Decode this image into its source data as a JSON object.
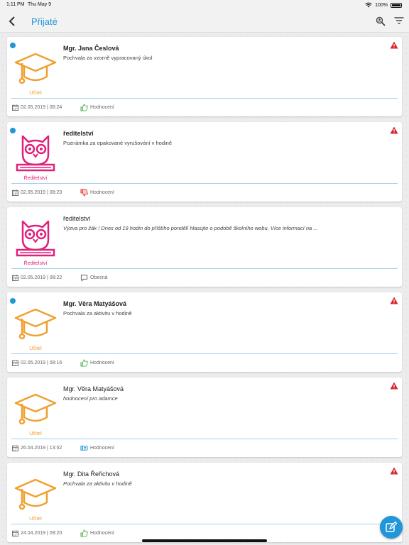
{
  "status_bar": {
    "time": "1:11 PM",
    "date": "Thu May 9",
    "battery": "100%"
  },
  "nav": {
    "title": "Přijaté"
  },
  "colors": {
    "accent": "#2196d8",
    "teacher": "#f0a030",
    "director": "#e0207a",
    "warning": "#d9252a",
    "like": "#4caf50",
    "dislike": "#e53935"
  },
  "messages": [
    {
      "sender": "Mgr. Jana Česlová",
      "subject": "Pochvala za vzorně vypracovaný úkol",
      "avatar": "graduation-cap-icon",
      "role": "Učitel",
      "datetime": "02.05.2019 | 08:24",
      "type": "Hodnocení",
      "type_icon": "thumbs-up-icon",
      "unread": true,
      "warning": true
    },
    {
      "sender": "ředitelství",
      "subject": "Poznámka za opakované vyrušování v hodině",
      "avatar": "owl-icon",
      "role": "Ředitelství",
      "datetime": "02.05.2019 | 08:23",
      "type": "Hodnocení",
      "type_icon": "thumbs-down-icon",
      "unread": true,
      "warning": true
    },
    {
      "sender": "ředitelství",
      "subject": "Výzva pro žák ! Dnes od 19 hodin do příštího pondělí hlasujte o podobě školního webu. Více informací na ...",
      "avatar": "owl-icon",
      "role": "Ředitelství",
      "datetime": "02.05.2019 | 08:22",
      "type": "Obecná",
      "type_icon": "chat-bubble-icon",
      "unread": false,
      "warning": false
    },
    {
      "sender": "Mgr. Věra Matyášová",
      "subject": "Pochvala za aktivitu v hodině",
      "avatar": "graduation-cap-icon",
      "role": "Učitel",
      "datetime": "02.05.2019 | 08:16",
      "type": "Hodnocení",
      "type_icon": "thumbs-up-icon",
      "unread": true,
      "warning": true
    },
    {
      "sender": "Mgr. Věra Matyášová",
      "subject": "hodnocení pro adamce",
      "avatar": "graduation-cap-icon",
      "role": "Učitel",
      "datetime": "26.04.2019 | 13:52",
      "type": "Hodnocení",
      "type_icon": "thumbs-neutral-icon",
      "unread": false,
      "warning": true
    },
    {
      "sender": "Mgr. Dita Řeřichová",
      "subject": "Pochvala za aktivitu v hodině",
      "avatar": "graduation-cap-icon",
      "role": "Učitel",
      "datetime": "24.04.2019 | 09:20",
      "type": "Hodnocení",
      "type_icon": "thumbs-up-icon",
      "unread": false,
      "warning": true
    }
  ]
}
